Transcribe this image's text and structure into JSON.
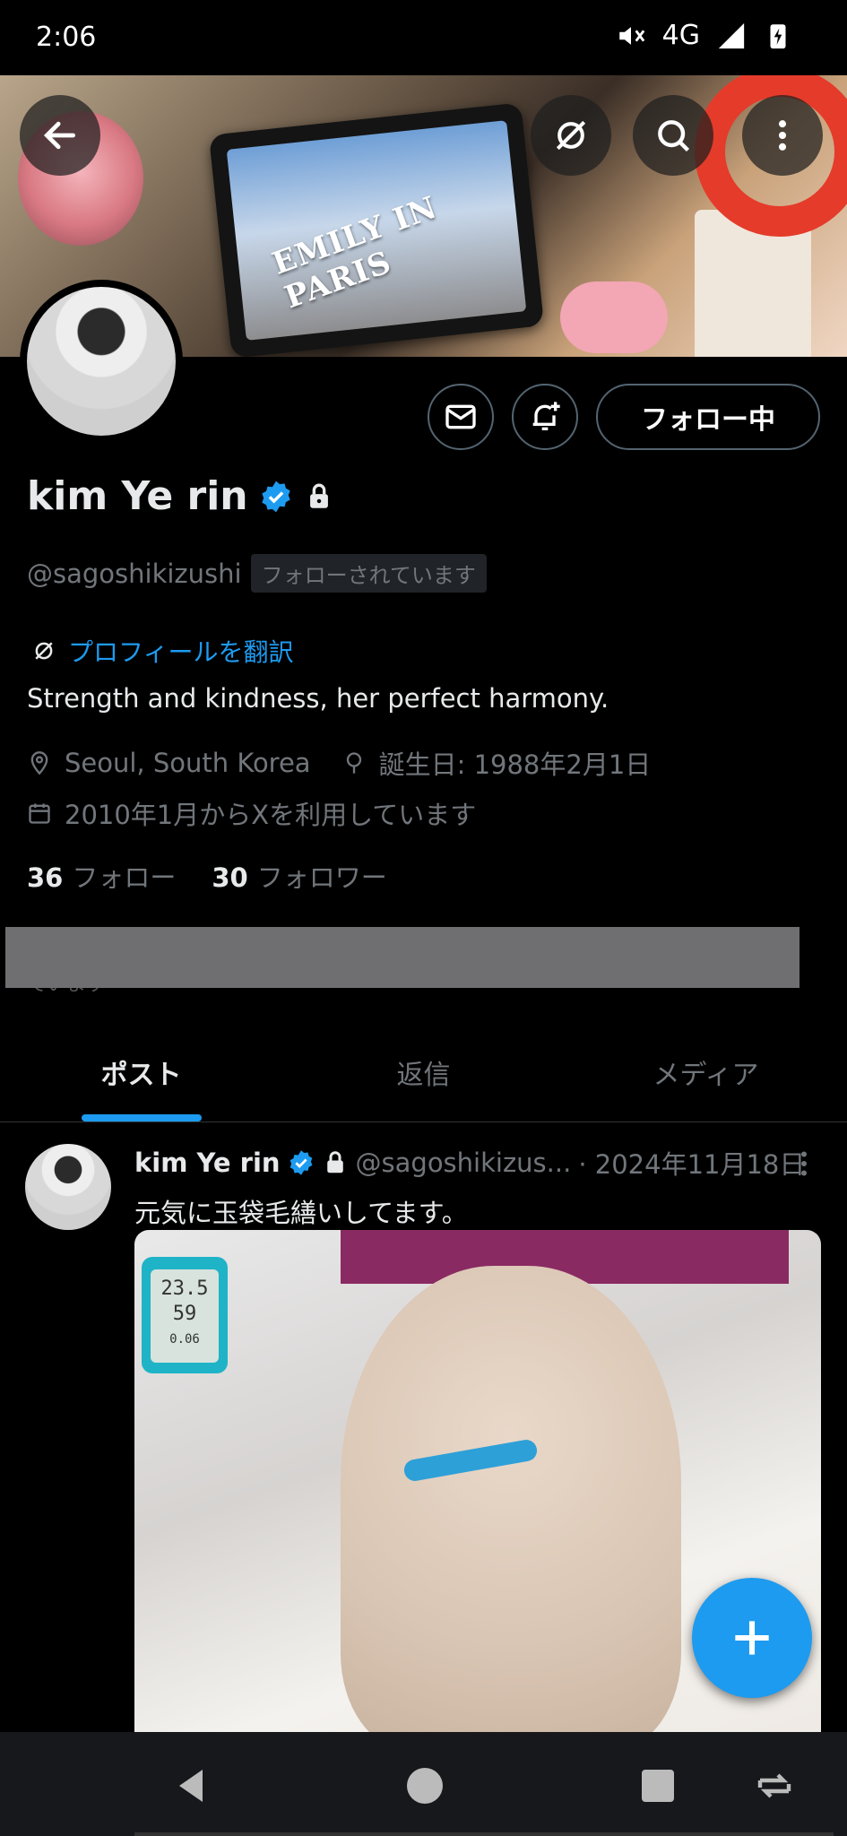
{
  "status_bar": {
    "time": "2:06",
    "network": "4G",
    "battery": "10"
  },
  "banner": {
    "tablet_text": "EMILY IN PARIS"
  },
  "profile": {
    "display_name": "kim Ye rin",
    "handle": "@sagoshikizushi",
    "follows_you_badge": "フォローされています",
    "translate_link": "プロフィールを翻訳",
    "bio": "Strength and kindness, her perfect harmony.",
    "location": "Seoul, South Korea",
    "birthday": "誕生日: 1988年2月1日",
    "joined": "2010年1月からXを利用しています",
    "following_count": "36",
    "following_label": "フォロー",
    "followers_count": "30",
    "followers_label": "フォロワー",
    "follow_button": "フォロー中",
    "followed_by_partial": "ています"
  },
  "tabs": [
    {
      "label": "ポスト",
      "active": true
    },
    {
      "label": "返信",
      "active": false
    },
    {
      "label": "メディア",
      "active": false
    }
  ],
  "post": {
    "author_name": "kim Ye rin",
    "author_handle": "@sagoshikizus...",
    "date": "· 2024年11月18日",
    "text": "元気に玉袋毛繕いしてます。",
    "thermo_line1": "23.5",
    "thermo_line2": "59",
    "thermo_line3": "0.06"
  },
  "colors": {
    "accent": "#1d9bf0",
    "background": "#000000",
    "secondary_text": "#71767b",
    "primary_text": "#e7e9ea",
    "annotation_ring": "#e53b2a"
  },
  "icons": [
    "back-arrow-icon",
    "translate-icon",
    "search-icon",
    "more-vert-icon",
    "message-icon",
    "bell-plus-icon",
    "verified-icon",
    "lock-icon",
    "location-icon",
    "birthday-icon",
    "calendar-icon",
    "compose-plus-icon",
    "nav-back-icon",
    "nav-home-icon",
    "nav-recents-icon",
    "rotate-icon"
  ]
}
